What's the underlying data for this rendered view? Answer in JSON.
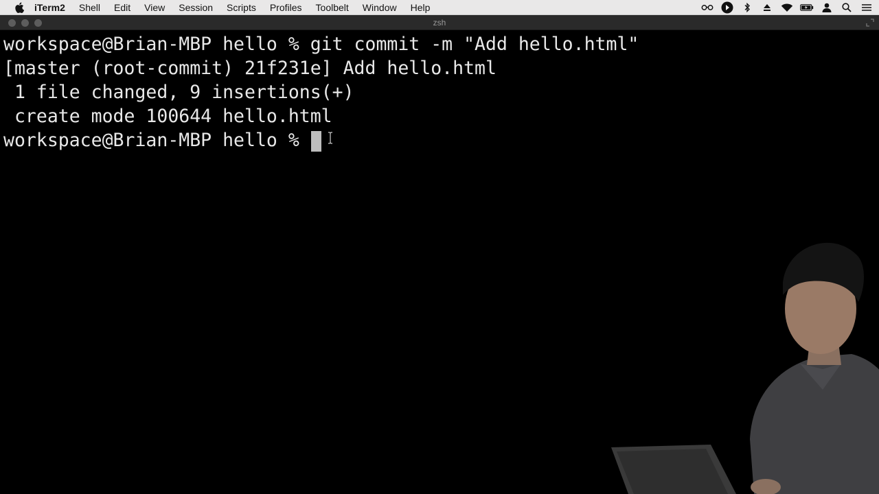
{
  "menubar": {
    "items": [
      {
        "label": "iTerm2",
        "name": "menu-app-iterm2"
      },
      {
        "label": "Shell",
        "name": "menu-shell"
      },
      {
        "label": "Edit",
        "name": "menu-edit"
      },
      {
        "label": "View",
        "name": "menu-view"
      },
      {
        "label": "Session",
        "name": "menu-session"
      },
      {
        "label": "Scripts",
        "name": "menu-scripts"
      },
      {
        "label": "Profiles",
        "name": "menu-profiles"
      },
      {
        "label": "Toolbelt",
        "name": "menu-toolbelt"
      },
      {
        "label": "Window",
        "name": "menu-window"
      },
      {
        "label": "Help",
        "name": "menu-help"
      }
    ],
    "status_icons": [
      "glasses-icon",
      "play-icon",
      "bluetooth-icon",
      "eject-icon",
      "wifi-icon",
      "battery-icon",
      "user-icon",
      "search-icon",
      "control-center-icon"
    ]
  },
  "window": {
    "title": "zsh"
  },
  "terminal": {
    "lines": [
      "workspace@Brian-MBP hello % git commit -m \"Add hello.html\"",
      "[master (root-commit) 21f231e] Add hello.html",
      " 1 file changed, 9 insertions(+)",
      " create mode 100644 hello.html",
      "workspace@Brian-MBP hello % "
    ]
  },
  "colors": {
    "terminal_background": "#000000",
    "terminal_text": "#e8e8e8",
    "menubar_background": "#e9e8e8",
    "cursor": "#bdbdbd"
  }
}
